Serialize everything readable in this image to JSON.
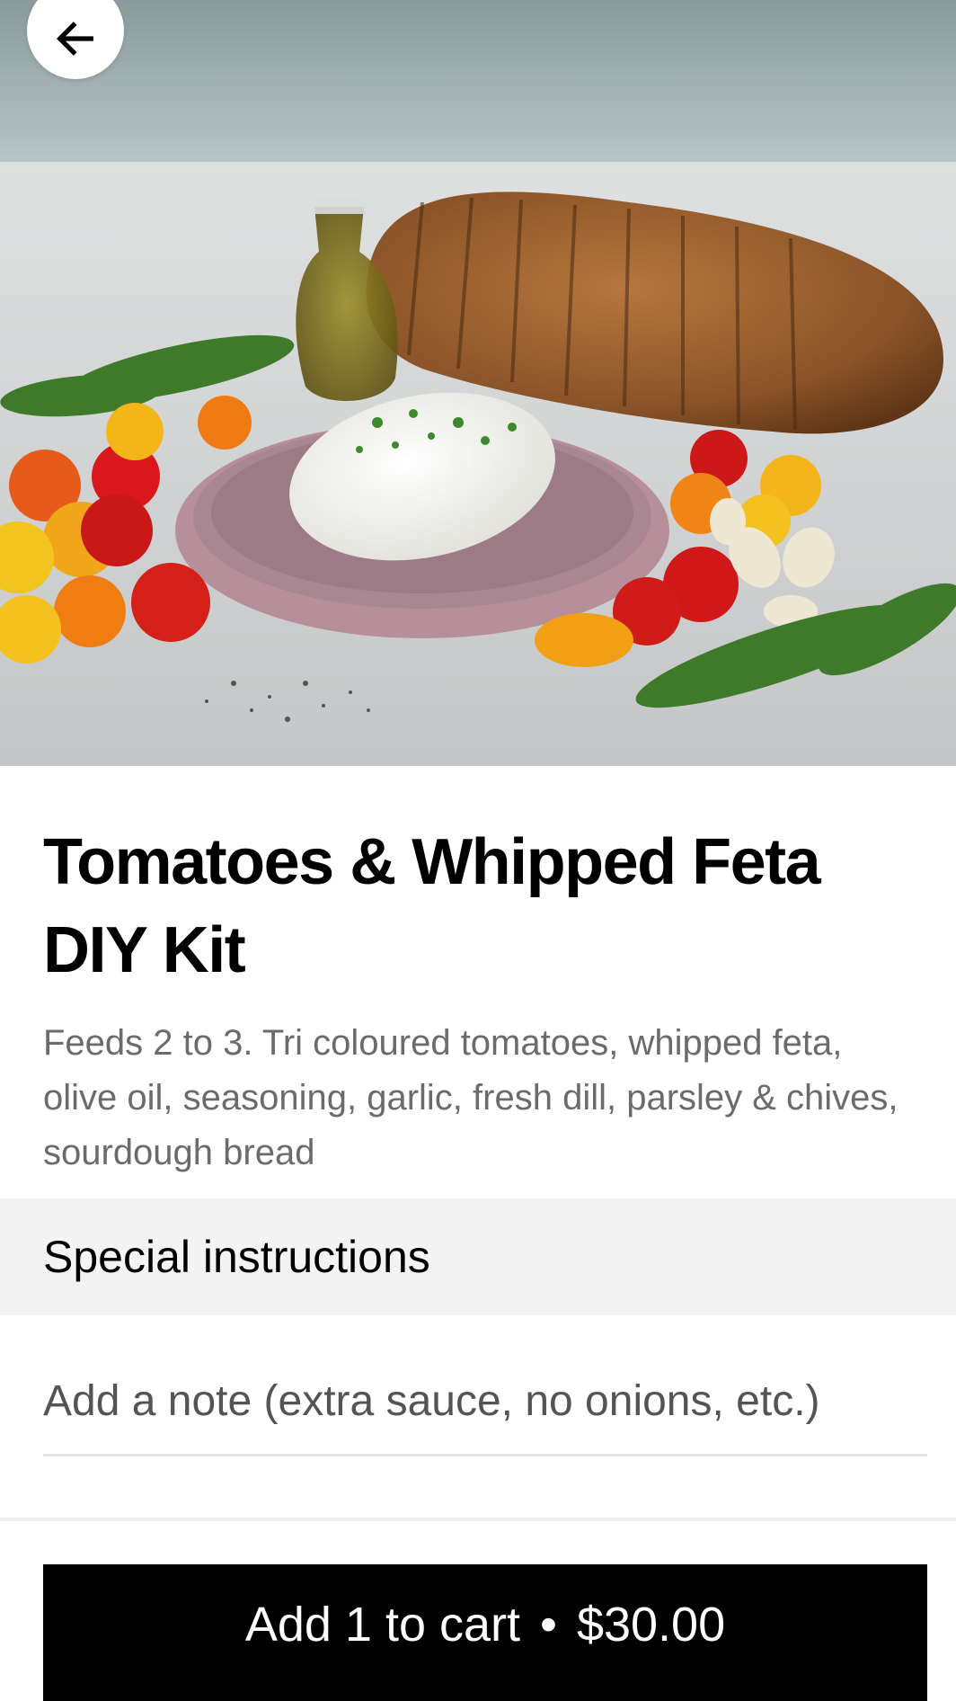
{
  "item": {
    "title": "Tomatoes & Whipped Feta DIY Kit",
    "description": "Feeds 2 to 3. Tri coloured tomatoes, whipped feta, olive oil, seasoning, garlic, fresh dill, parsley & chives, sourdough bread"
  },
  "special_instructions": {
    "heading": "Special instructions",
    "note_placeholder": "Add a note (extra sauce, no onions, etc.)",
    "note_value": ""
  },
  "cart_button": {
    "label": "Add 1 to cart",
    "separator": "•",
    "price": "$30.00"
  },
  "icons": {
    "back": "arrow-left-icon"
  }
}
